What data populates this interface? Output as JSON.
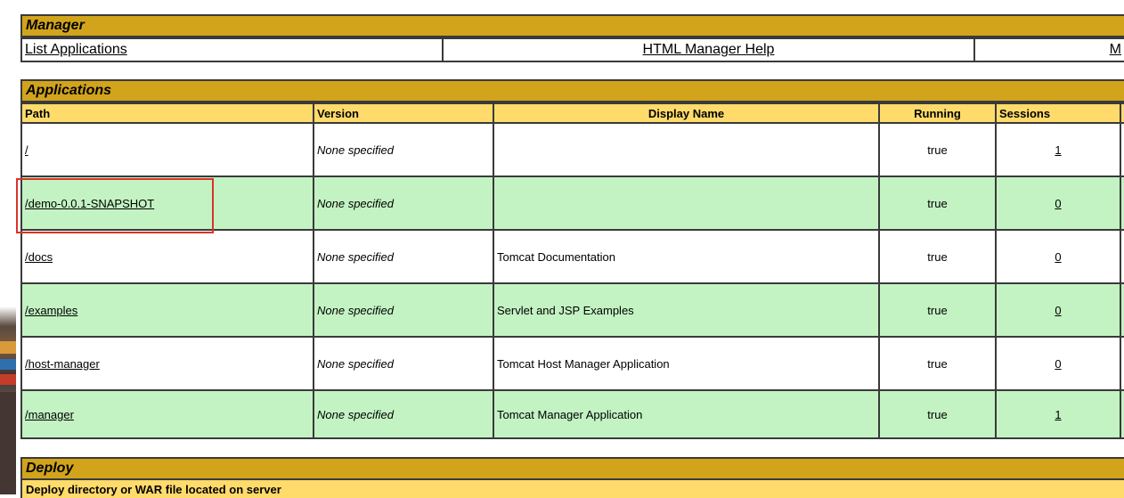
{
  "manager": {
    "title": "Manager",
    "links": [
      {
        "label": "List Applications"
      },
      {
        "label": "HTML Manager Help"
      },
      {
        "label": "M"
      }
    ]
  },
  "applications": {
    "title": "Applications",
    "columns": [
      "Path",
      "Version",
      "Display Name",
      "Running",
      "Sessions"
    ],
    "rows": [
      {
        "path": "/",
        "version": "None specified",
        "display_name": "",
        "running": "true",
        "sessions": "1"
      },
      {
        "path": "/demo-0.0.1-SNAPSHOT",
        "version": "None specified",
        "display_name": "",
        "running": "true",
        "sessions": "0"
      },
      {
        "path": "/docs",
        "version": "None specified",
        "display_name": "Tomcat Documentation",
        "running": "true",
        "sessions": "0"
      },
      {
        "path": "/examples",
        "version": "None specified",
        "display_name": "Servlet and JSP Examples",
        "running": "true",
        "sessions": "0"
      },
      {
        "path": "/host-manager",
        "version": "None specified",
        "display_name": "Tomcat Host Manager Application",
        "running": "true",
        "sessions": "0"
      },
      {
        "path": "/manager",
        "version": "None specified",
        "display_name": "Tomcat Manager Application",
        "running": "true",
        "sessions": "1"
      }
    ]
  },
  "deploy": {
    "title": "Deploy",
    "subtitle": "Deploy directory or WAR file located on server"
  },
  "colors": {
    "section_header": "#d2a41c",
    "column_header": "#ffdb6b",
    "row_alt": "#c3f3c3",
    "highlight_box": "#d9342b"
  }
}
